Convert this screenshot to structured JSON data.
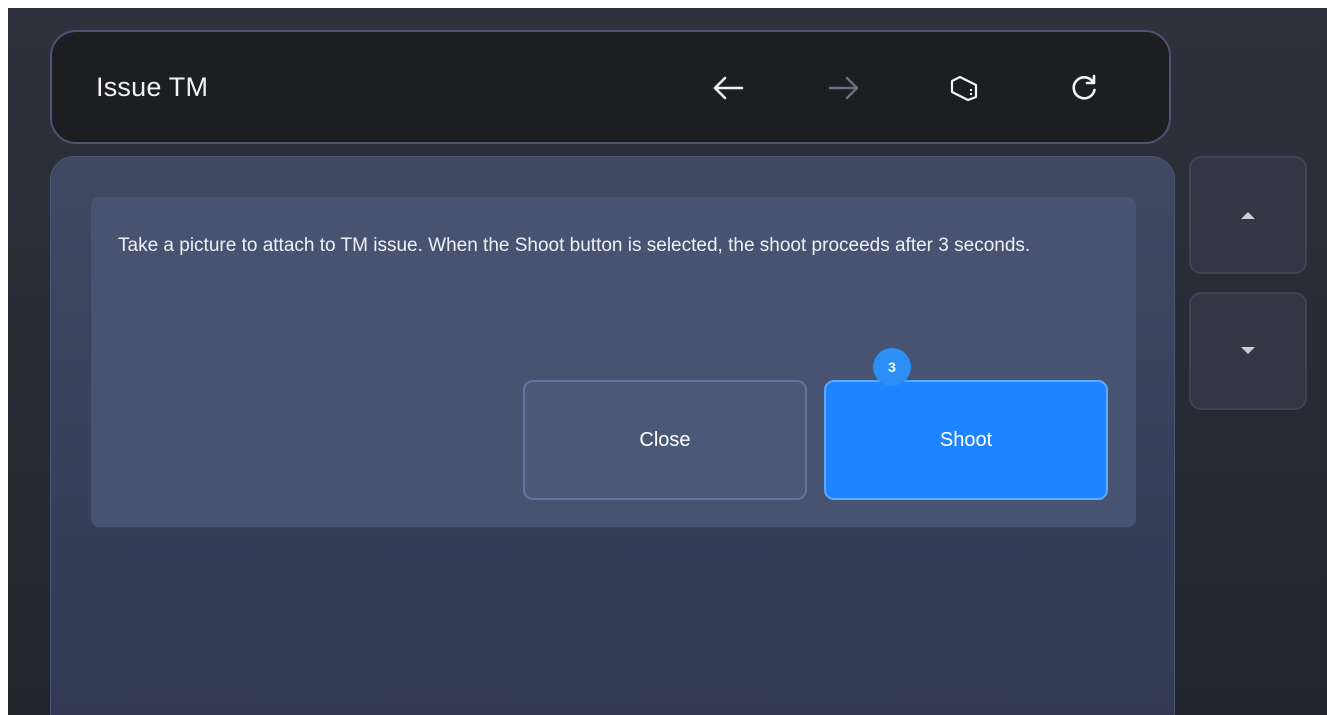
{
  "header": {
    "title": "Issue TM",
    "icons": {
      "back": "arrow-left-icon",
      "forward": "arrow-right-icon",
      "screenshot": "screenshot-icon",
      "refresh": "refresh-icon"
    },
    "forward_enabled": false
  },
  "dialog": {
    "message": "Take a picture to attach to TM issue. When the Shoot button is selected, the shoot proceeds after 3 seconds.",
    "close_label": "Close",
    "shoot_label": "Shoot",
    "countdown": "3"
  },
  "scroll": {
    "up_icon": "caret-up-icon",
    "down_icon": "caret-down-icon"
  },
  "colors": {
    "accent": "#1f84ff",
    "badge": "#2b8ff6",
    "header_bg": "#1d1e22",
    "panel_bg": "#3f4962"
  }
}
